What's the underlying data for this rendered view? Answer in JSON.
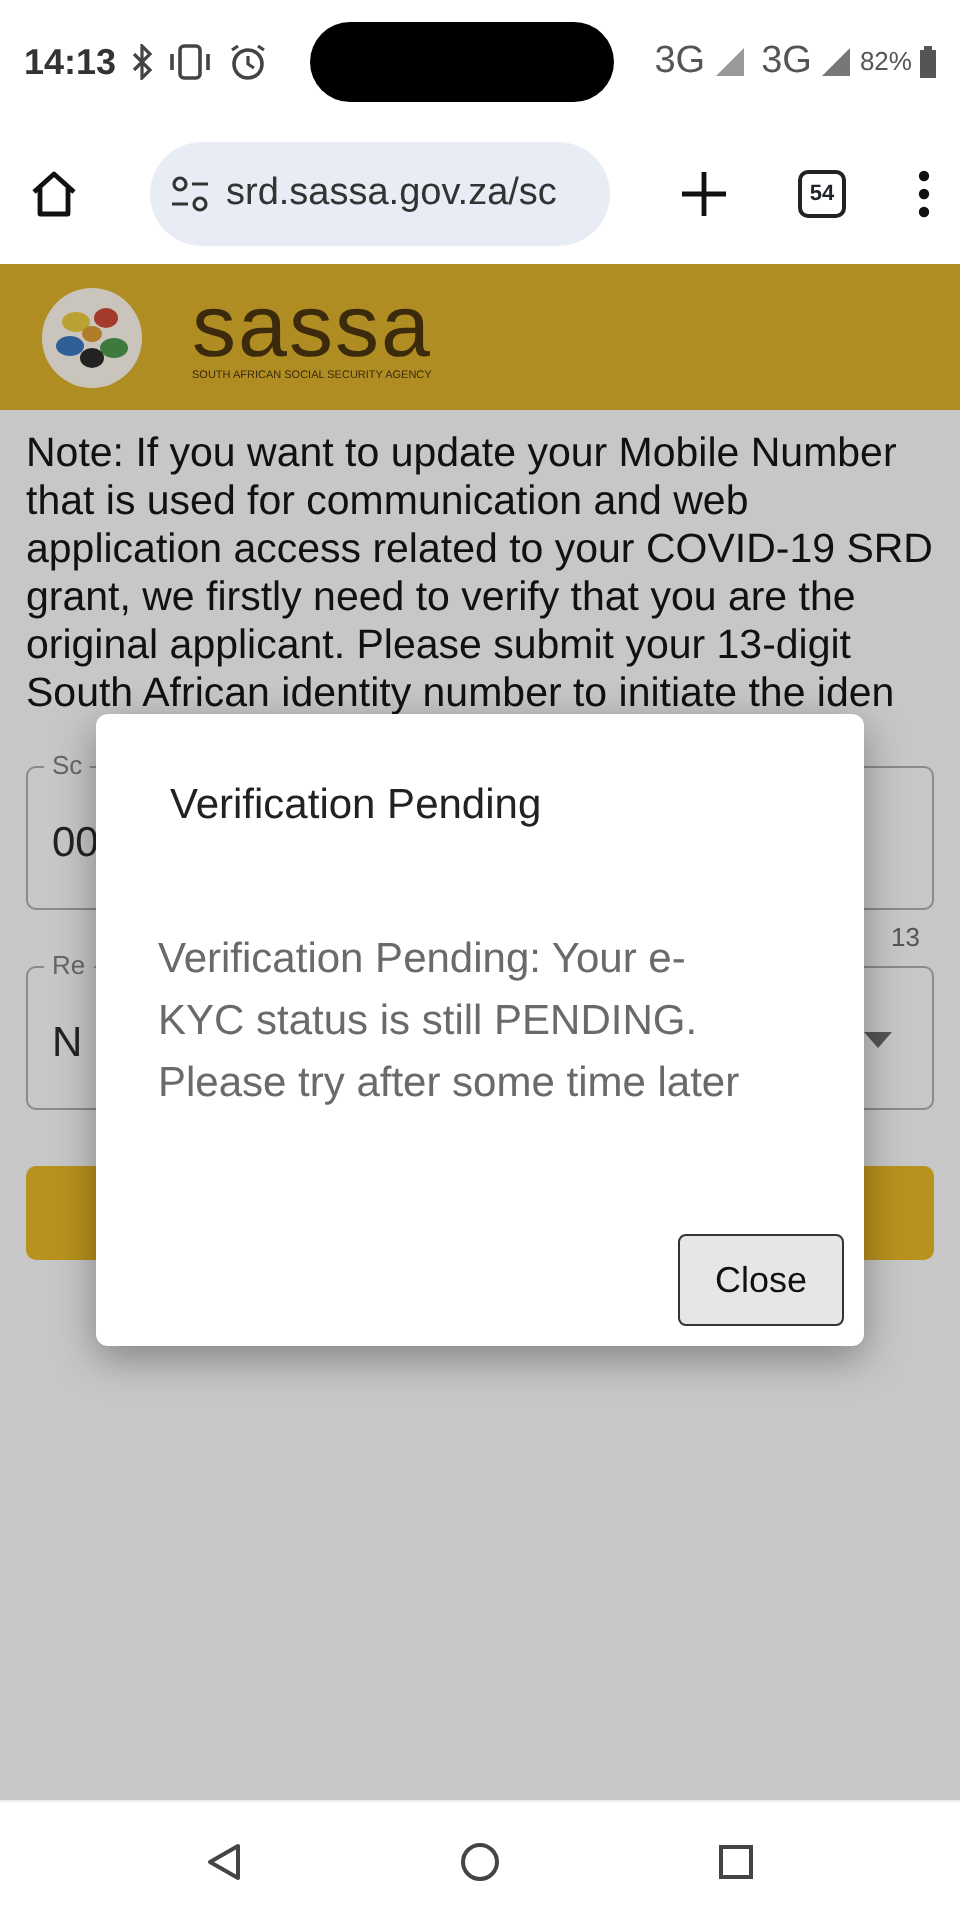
{
  "status_bar": {
    "time": "14:13",
    "network_1": "3G",
    "network_2": "3G",
    "battery": "82%"
  },
  "browser": {
    "url": "srd.sassa.gov.za/sc",
    "tab_count": "54"
  },
  "header": {
    "logo_text": "sassa",
    "logo_subtitle": "SOUTH AFRICAN SOCIAL SECURITY AGENCY"
  },
  "note": "Note: If you want to update your Mobile Number that is used for communication and web application access related to your COVID-19 SRD grant, we firstly need to verify that you are the original applicant. Please submit your 13-digit South African identity number to initiate the iden",
  "fields": [
    {
      "kind": "text",
      "label": "Sc",
      "value": "00"
    },
    {
      "kind": "select",
      "label": "Re",
      "value": "N"
    }
  ],
  "field_hint": "13",
  "dialog": {
    "title": "Verification Pending",
    "message": "Verification Pending: Your e-KYC status is still PENDING. Please try after some time later",
    "buttons": [
      "Close"
    ]
  }
}
